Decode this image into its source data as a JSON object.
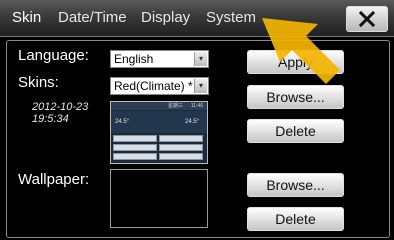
{
  "tabs": [
    {
      "label": "Skin",
      "active": true
    },
    {
      "label": "Date/Time",
      "active": false
    },
    {
      "label": "Display",
      "active": false
    },
    {
      "label": "System",
      "active": false
    }
  ],
  "close_icon": "close-x-icon",
  "language": {
    "label": "Language:",
    "value": "English"
  },
  "skins": {
    "label": "Skins:",
    "value": "Red(Climate) *"
  },
  "skin_timestamp": {
    "date": "2012-10-23",
    "time": "19:5:34"
  },
  "buttons": {
    "apply": "Apply",
    "browse_skin": "Browse...",
    "delete_skin": "Delete",
    "browse_wallpaper": "Browse...",
    "delete_wallpaper": "Delete"
  },
  "wallpaper": {
    "label": "Wallpaper:"
  },
  "preview": {
    "day": "星期三",
    "time": "11:46",
    "temp_left": "24.5°",
    "temp_right": "24.5°"
  },
  "colors": {
    "cursor": "#f5b400",
    "panel_bg": "#000000",
    "button_face": "#e2e2e2"
  }
}
